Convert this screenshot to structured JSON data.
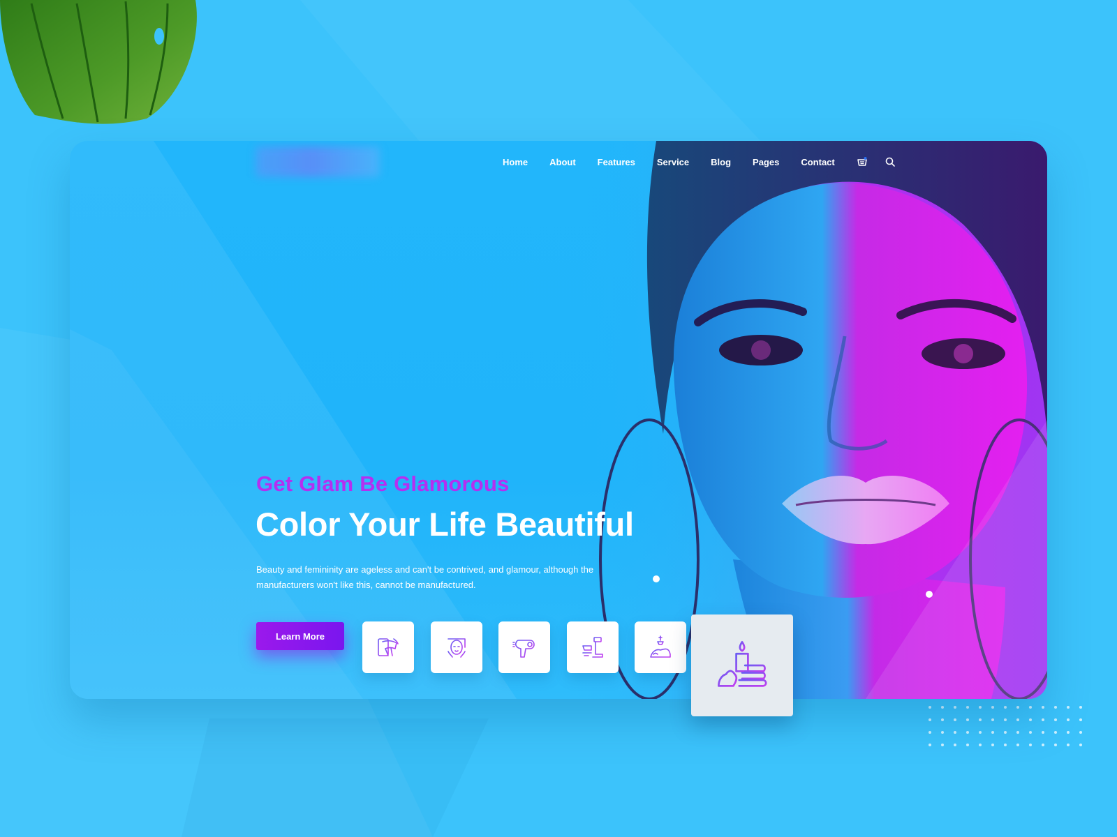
{
  "nav": {
    "items": [
      {
        "label": "Home"
      },
      {
        "label": "About"
      },
      {
        "label": "Features"
      },
      {
        "label": "Service"
      },
      {
        "label": "Blog"
      },
      {
        "label": "Pages"
      },
      {
        "label": "Contact"
      }
    ],
    "icons": [
      "cart-icon",
      "search-icon"
    ]
  },
  "hero": {
    "tagline": "Get Glam Be Glamorous",
    "headline": "Color Your Life Beautiful",
    "description": "Beauty and femininity are ageless and can't be contrived, and glamour, although the manufacturers won't like this, cannot be manufactured.",
    "cta_label": "Learn More"
  },
  "services": [
    {
      "icon": "body-massage-icon",
      "active": false
    },
    {
      "icon": "face-care-icon",
      "active": false
    },
    {
      "icon": "hair-dryer-icon",
      "active": false
    },
    {
      "icon": "pedicure-icon",
      "active": false
    },
    {
      "icon": "foot-spa-icon",
      "active": false
    },
    {
      "icon": "spa-stones-candle-icon",
      "active": true
    }
  ],
  "colors": {
    "page_background": "#3cc3fb",
    "card_background": "#22b6fb",
    "accent_purple": "#b52ff0",
    "button_gradient_start": "#9b19ec",
    "button_gradient_end": "#7a16ee",
    "icon_gradient_start": "#6a5cf2",
    "icon_gradient_end": "#c43ef0"
  }
}
